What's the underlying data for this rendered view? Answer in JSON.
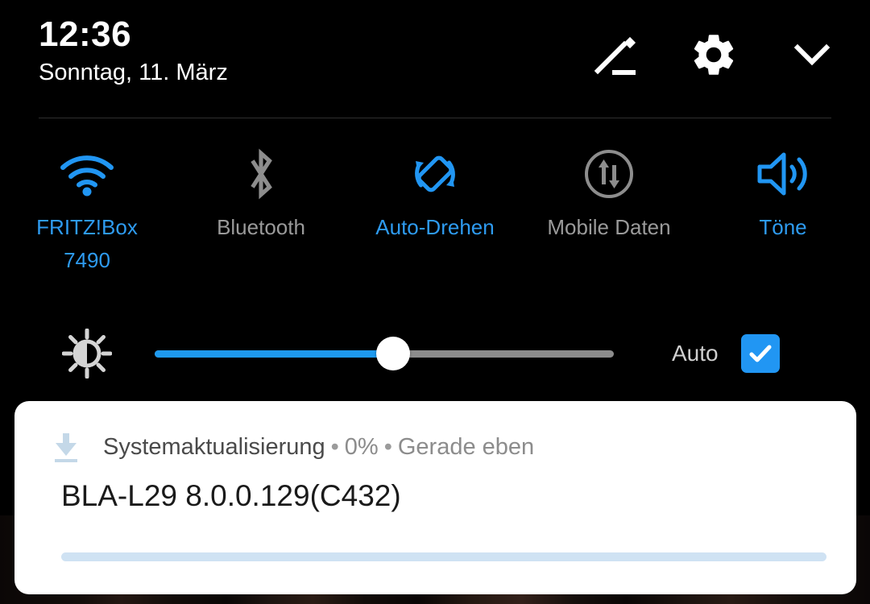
{
  "status_bar": {
    "time": "12:36",
    "date": "Sonntag, 11. März"
  },
  "header_actions": [
    {
      "name": "edit-icon",
      "label": "Bearbeiten"
    },
    {
      "name": "gear-icon",
      "label": "Einstellungen"
    },
    {
      "name": "chevron-down-icon",
      "label": "Einklappen"
    }
  ],
  "quick_settings": {
    "tiles": [
      {
        "id": "wifi",
        "icon": "wifi-icon",
        "label": "FRITZ!Box 7490",
        "state": "on"
      },
      {
        "id": "bluetooth",
        "icon": "bluetooth-icon",
        "label": "Bluetooth",
        "state": "off"
      },
      {
        "id": "autorotate",
        "icon": "auto-rotate-icon",
        "label": "Auto-Drehen",
        "state": "on"
      },
      {
        "id": "mobiledata",
        "icon": "mobile-data-icon",
        "label": "Mobile Daten",
        "state": "off"
      },
      {
        "id": "sound",
        "icon": "volume-icon",
        "label": "Töne",
        "state": "on"
      }
    ],
    "active_color": "#2e9bf0",
    "inactive_color": "#9a9a9a"
  },
  "brightness": {
    "icon": "brightness-icon",
    "value_percent": 52,
    "auto_label": "Auto",
    "auto_checked": true,
    "fill_color": "#1e9af0",
    "track_color": "#8c8c8c"
  },
  "notification": {
    "app_icon": "download-icon",
    "app_name": "Systemaktualisierung",
    "separator": "•",
    "progress_text": "0%",
    "time_text": "Gerade eben",
    "title": "BLA-L29 8.0.0.129(C432)",
    "progress_percent": 0,
    "progress_track_color": "#cfe2f3",
    "progress_fill_color": "#2196f3"
  }
}
